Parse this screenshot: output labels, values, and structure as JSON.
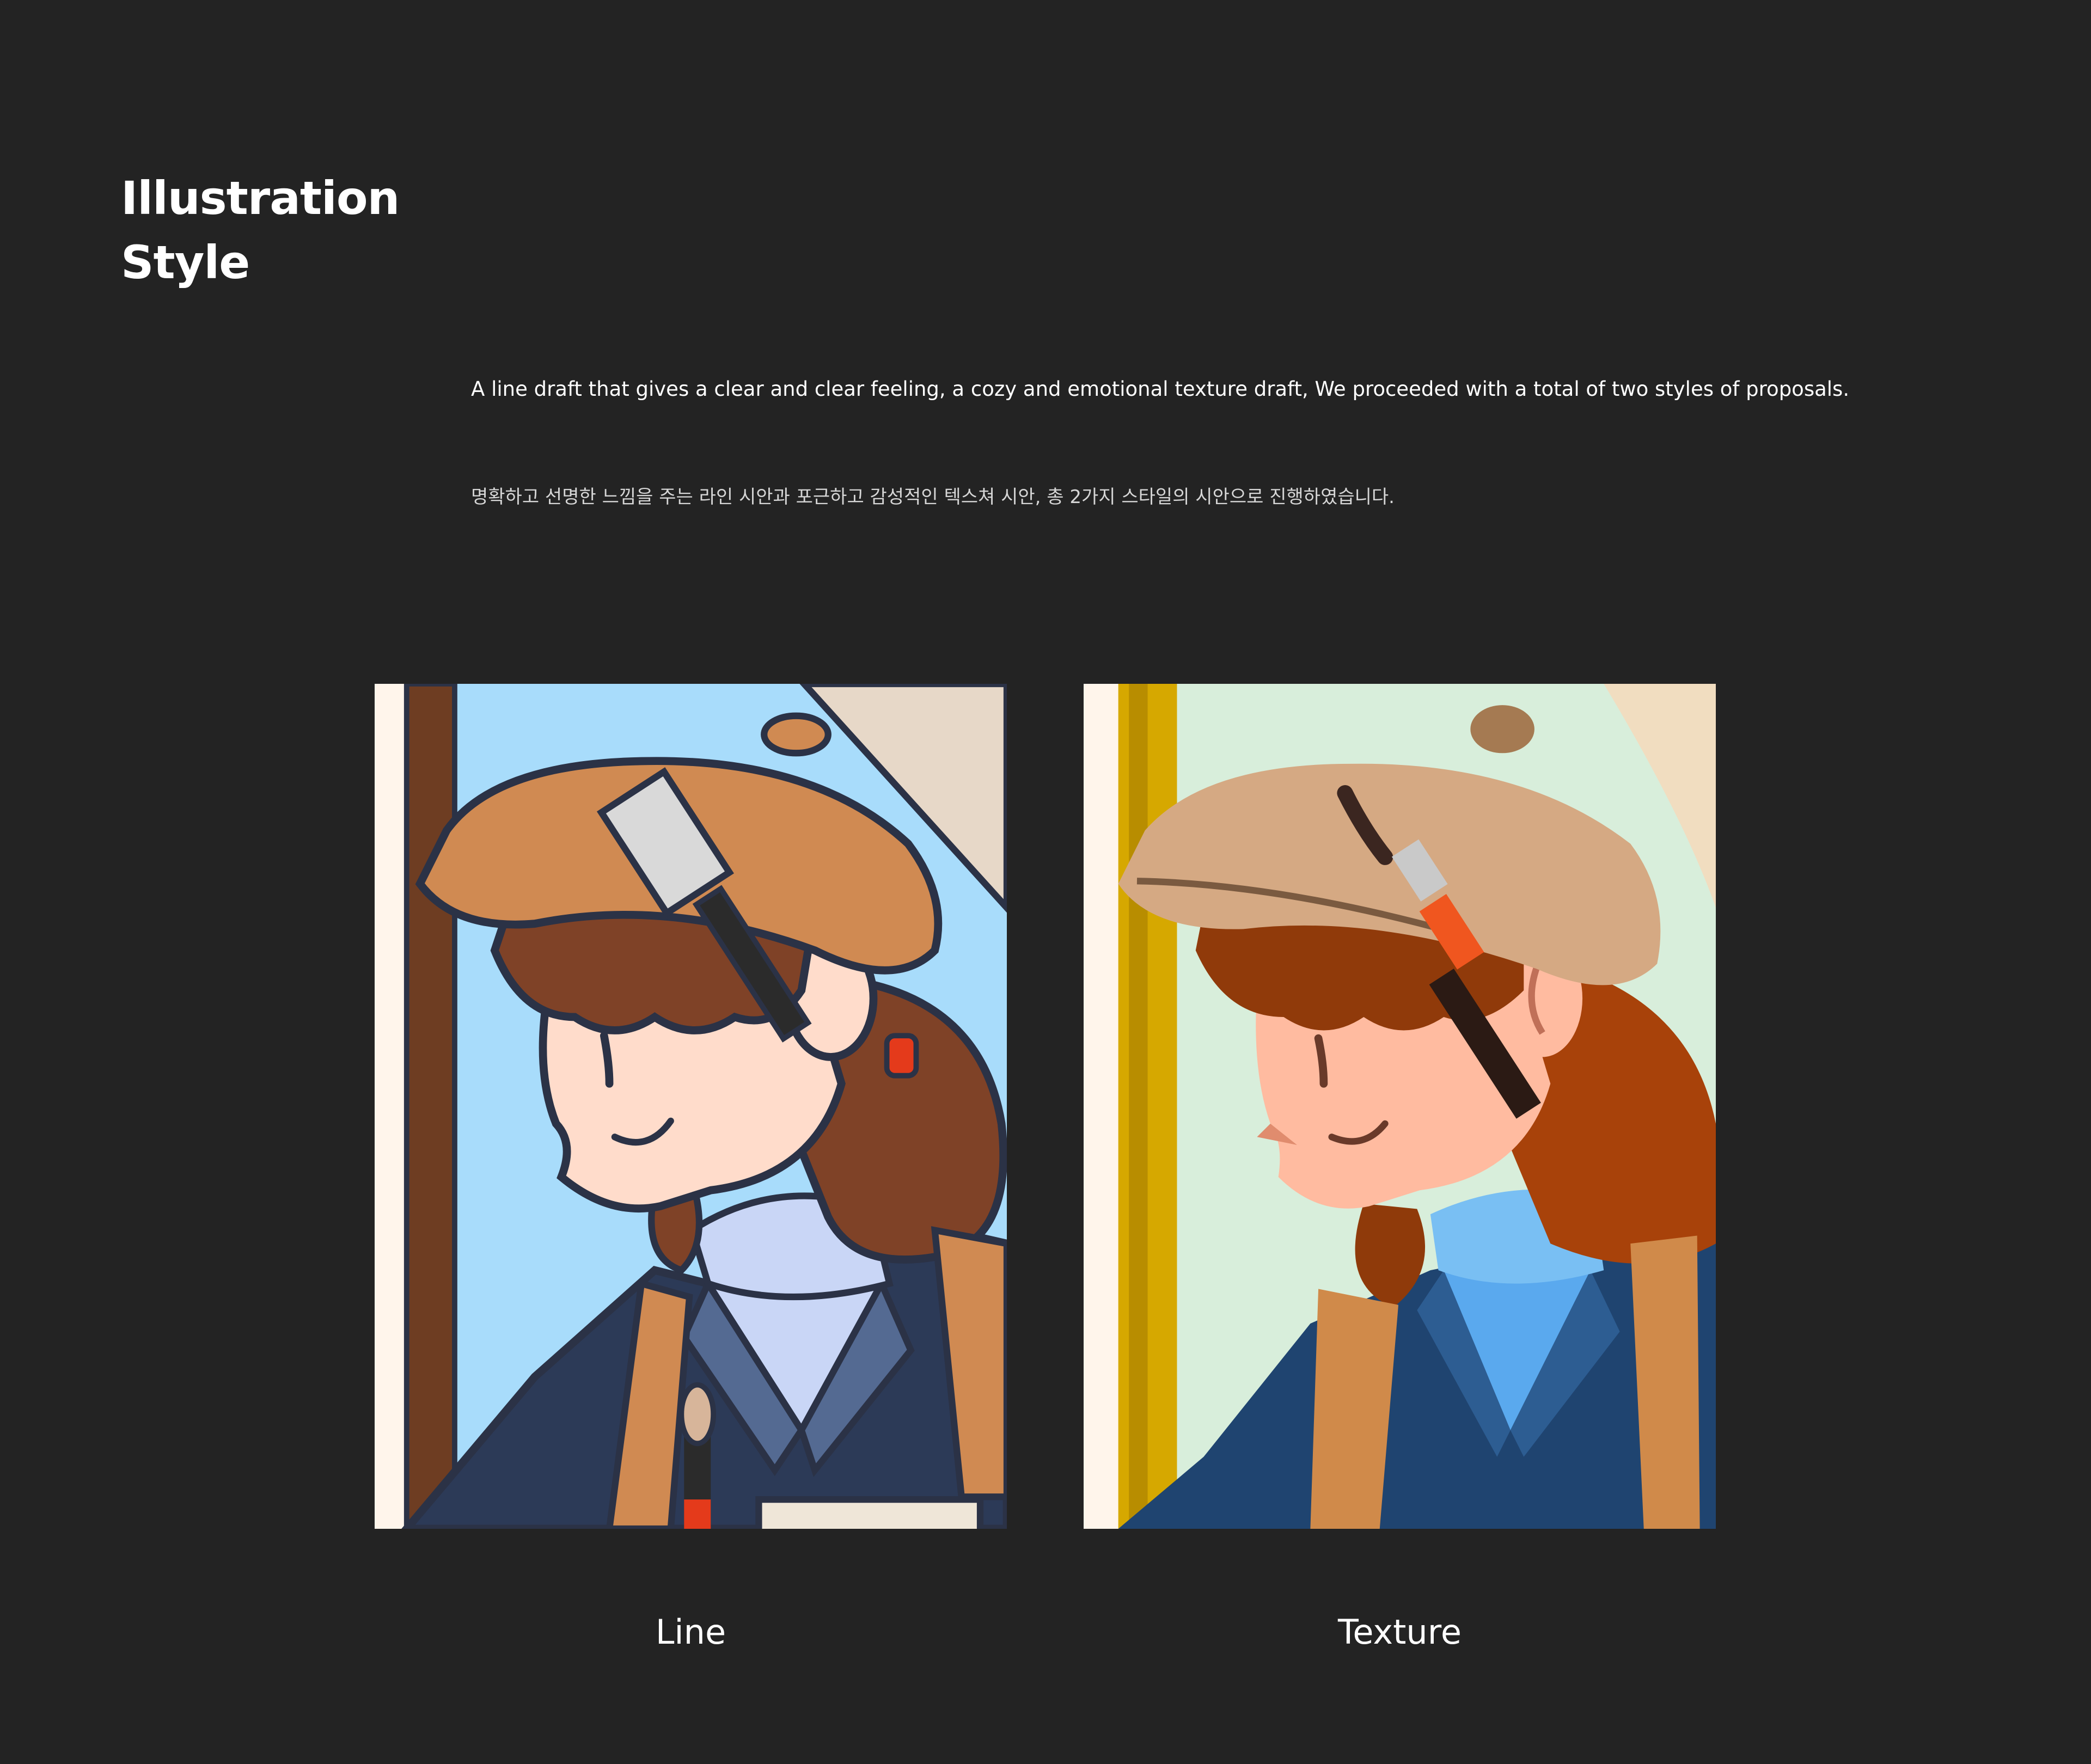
{
  "section": {
    "title_line1": "Illustration",
    "title_line2": "Style"
  },
  "description": {
    "english": "A line draft that gives a clear and clear feeling, a cozy and emotional texture draft, We proceeded with a total of two styles of proposals.",
    "korean": "명확하고 선명한 느낌을 주는 라인 시안과 포근하고 감성적인 텍스쳐 시안, 총 2가지 스타일의 시안으로 진행하였습니다."
  },
  "illustrations": [
    {
      "caption": "Line",
      "colors": {
        "sky": "#a8dcfb",
        "hat": "#d08a52",
        "hair": "#7f4227",
        "skin": "#ffdccb",
        "jacket": "#2c3a57",
        "outline": "#2b3246"
      }
    },
    {
      "caption": "Texture",
      "colors": {
        "sky": "#d8eedb",
        "hat": "#d5a983",
        "hair": "#a8420a",
        "skin": "#ffbba0",
        "jacket": "#1f4470",
        "frame": "#d6a800"
      }
    }
  ]
}
